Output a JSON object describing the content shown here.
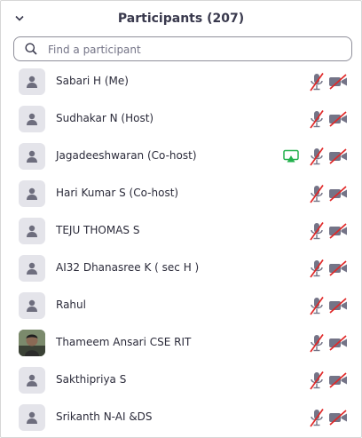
{
  "header": {
    "title": "Participants (207)",
    "collapse_icon": "chevron-down-icon"
  },
  "search": {
    "placeholder": "Find a participant",
    "value": "",
    "icon": "search-icon"
  },
  "colors": {
    "muted_red": "#e02828",
    "icon_gray": "#747487",
    "share_green": "#23b14d"
  },
  "participants": [
    {
      "name": "Sabari H (Me)",
      "avatar": "default-avatar-icon",
      "sharing": false,
      "audio": "muted",
      "video": "off"
    },
    {
      "name": "Sudhakar N (Host)",
      "avatar": "default-avatar-icon",
      "sharing": false,
      "audio": "muted",
      "video": "off"
    },
    {
      "name": "Jagadeeshwaran (Co-host)",
      "avatar": "default-avatar-icon",
      "sharing": true,
      "audio": "muted",
      "video": "off"
    },
    {
      "name": "Hari Kumar S (Co-host)",
      "avatar": "default-avatar-icon",
      "sharing": false,
      "audio": "muted",
      "video": "off"
    },
    {
      "name": "TEJU THOMAS S",
      "avatar": "default-avatar-icon",
      "sharing": false,
      "audio": "muted",
      "video": "off"
    },
    {
      "name": "AI32 Dhanasree K ( sec H )",
      "avatar": "default-avatar-icon",
      "sharing": false,
      "audio": "muted",
      "video": "off"
    },
    {
      "name": "Rahul",
      "avatar": "default-avatar-icon",
      "sharing": false,
      "audio": "muted",
      "video": "off"
    },
    {
      "name": "Thameem Ansari CSE RIT",
      "avatar": "profile-photo",
      "sharing": false,
      "audio": "muted",
      "video": "off"
    },
    {
      "name": "Sakthipriya S",
      "avatar": "default-avatar-icon",
      "sharing": false,
      "audio": "muted",
      "video": "off"
    },
    {
      "name": "Srikanth N-AI &DS",
      "avatar": "default-avatar-icon",
      "sharing": false,
      "audio": "muted",
      "video": "off"
    }
  ]
}
